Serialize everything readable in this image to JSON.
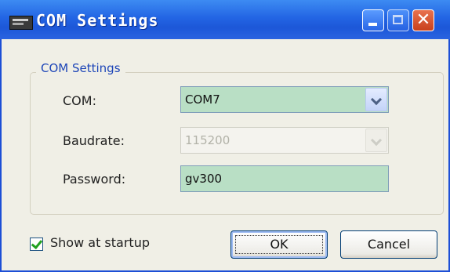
{
  "window": {
    "title": "COM Settings",
    "icon": "serial-port-icon",
    "controls": {
      "minimize": "minimize-icon",
      "maximize": "maximize-icon",
      "close_glyph": "✕"
    }
  },
  "group": {
    "title": "COM Settings",
    "fields": {
      "com": {
        "label": "COM:",
        "value": "COM7"
      },
      "baudrate": {
        "label": "Baudrate:",
        "value": "115200",
        "disabled": true
      },
      "password": {
        "label": "Password:",
        "value": "gv300"
      }
    }
  },
  "footer": {
    "show_at_startup": {
      "label": "Show at startup",
      "checked": true
    },
    "ok_label": "OK",
    "cancel_label": "Cancel"
  },
  "colors": {
    "titlebar": "#2365e4",
    "field_highlight": "#b9dfc5",
    "group_title": "#1e46b8",
    "window_bg": "#f0efe6"
  }
}
